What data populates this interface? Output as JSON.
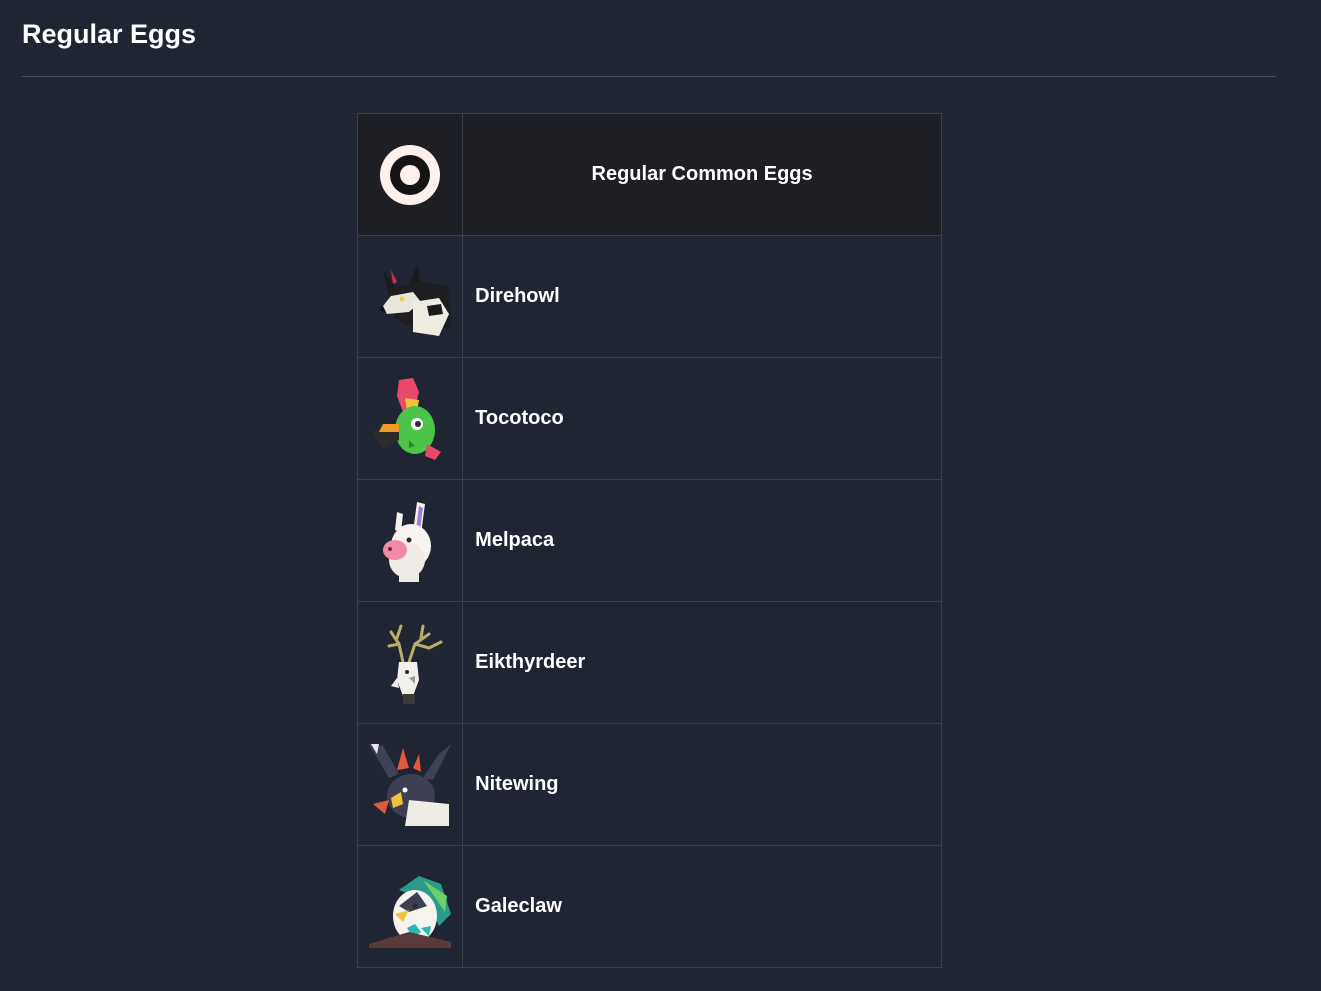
{
  "page": {
    "title": "Regular Eggs"
  },
  "table": {
    "header_icon": "egg-icon",
    "header_label": "Regular Common Eggs",
    "rows": [
      {
        "name": "Direhowl",
        "icon": "direhowl-icon"
      },
      {
        "name": "Tocotoco",
        "icon": "tocotoco-icon"
      },
      {
        "name": "Melpaca",
        "icon": "melpaca-icon"
      },
      {
        "name": "Eikthyrdeer",
        "icon": "eikthyrdeer-icon"
      },
      {
        "name": "Nitewing",
        "icon": "nitewing-icon"
      },
      {
        "name": "Galeclaw",
        "icon": "galeclaw-icon"
      }
    ]
  },
  "colors": {
    "background": "#202533",
    "header_background": "#1d1f25",
    "border": "#3a3f4c",
    "text": "#ffffff"
  }
}
